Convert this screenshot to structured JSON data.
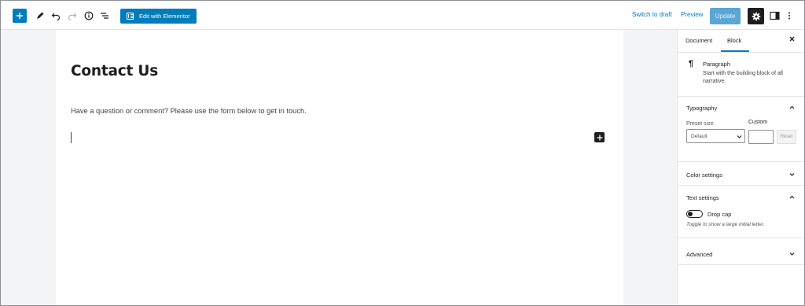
{
  "toolbar": {
    "add_icon": "plus-icon",
    "tools_icon": "pencil-icon",
    "undo_icon": "undo-icon",
    "redo_icon": "redo-icon",
    "info_icon": "info-icon",
    "outline_icon": "list-view-icon",
    "elementor_label": "Edit with Elementor",
    "switch_to_draft": "Switch to draft",
    "preview": "Preview",
    "update": "Update",
    "settings_icon": "gear-icon",
    "sidebar_icon": "sidebar-toggle-icon",
    "more_icon": "more-vertical-icon",
    "accent_color": "#007cba"
  },
  "editor": {
    "title": "Contact Us",
    "paragraph": "Have a question or comment?  Please use the form below to get in touch."
  },
  "sidebar": {
    "tabs": [
      "Document",
      "Block"
    ],
    "active_tab": "Block",
    "block": {
      "icon": "paragraph-icon",
      "name": "Paragraph",
      "description": "Start with the building block of all narrative."
    },
    "typography": {
      "title": "Typography",
      "preset_label": "Preset size",
      "preset_value": "Default",
      "custom_label": "Custom",
      "reset": "Reset"
    },
    "color_settings": "Color settings",
    "text_settings": {
      "title": "Text settings",
      "drop_cap": "Drop cap",
      "help": "Toggle to show a large initial letter."
    },
    "advanced": "Advanced"
  }
}
